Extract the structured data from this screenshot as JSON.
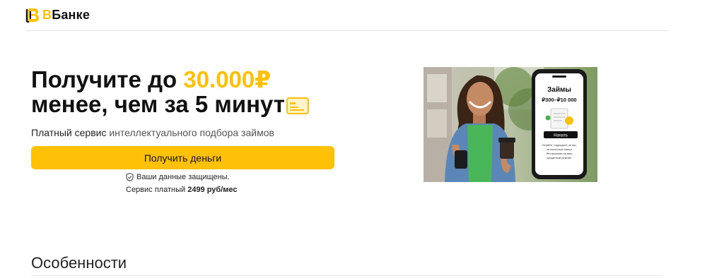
{
  "brand": {
    "name_prefix": "В",
    "name_rest": "Банке",
    "accent": "#FFC107"
  },
  "hero": {
    "title_part1": "Получите до ",
    "title_amount": "30.000₽",
    "title_line2": "менее, чем за 5 минут",
    "subtitle_main": "Платный сервис",
    "subtitle_rest": " интеллектуального подбора займов",
    "cta_label": "Получить деньги",
    "secure_note": "Ваши данные защищены.",
    "price_prefix": "Сервис платный ",
    "price_value": "2499 руб/мес"
  },
  "phone": {
    "title": "Займы",
    "range": "₽300–₽10 000",
    "button": "Начать",
    "text_line1": "Узнайте, подходите ли вы,",
    "text_line2": "за несколько минут",
    "text_line3": "без влияния на ваш",
    "text_line4": "кредитный рейтинг"
  },
  "features": {
    "title": "Особенности"
  }
}
